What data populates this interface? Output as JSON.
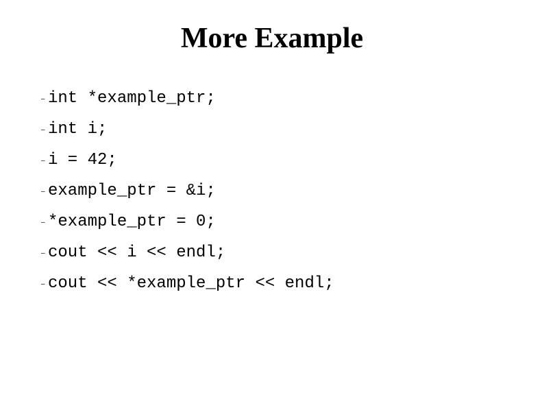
{
  "title": "More Example",
  "lines": [
    "int *example_ptr;",
    "int i;",
    "i = 42;",
    "example_ptr = &i;",
    "*example_ptr = 0;",
    "cout << i << endl;",
    "cout << *example_ptr << endl;"
  ],
  "bullet_char": "–"
}
